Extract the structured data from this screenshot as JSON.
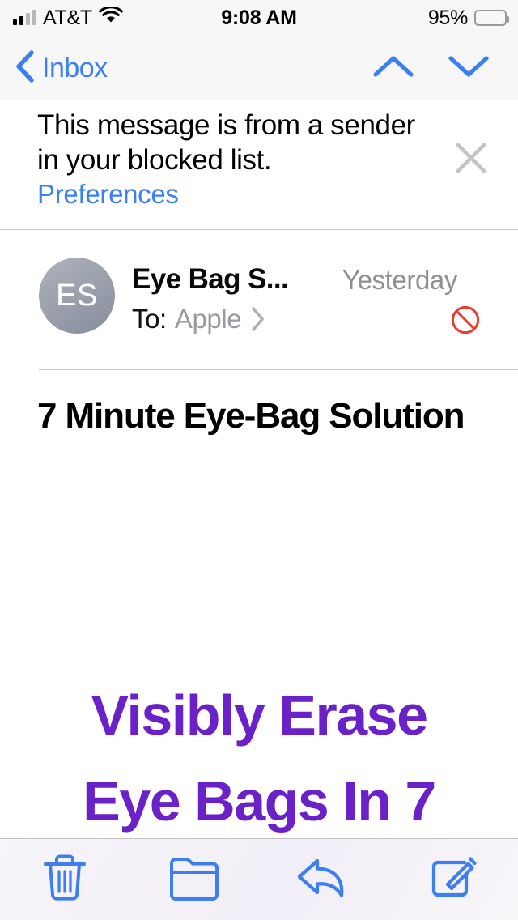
{
  "status_bar": {
    "carrier": "AT&T",
    "time": "9:08 AM",
    "battery_percent": "95%",
    "signal_icon": "signal-bars-icon",
    "wifi_icon": "wifi-icon",
    "battery_icon": "battery-icon"
  },
  "nav_bar": {
    "back_label": "Inbox",
    "back_icon": "chevron-left-icon",
    "previous_message_icon": "chevron-up-icon",
    "next_message_icon": "chevron-down-icon"
  },
  "blocked_banner": {
    "message": "This message is from a sender in your blocked list.",
    "link_label": "Preferences",
    "close_icon": "close-x-icon"
  },
  "sender": {
    "avatar_initials": "ES",
    "name": "Eye Bag S...",
    "date": "Yesterday",
    "to_label": "To:",
    "to_value": "Apple",
    "disclosure_icon": "chevron-right-icon",
    "blocked_icon": "blocked-circle-slash-icon"
  },
  "message": {
    "subject": "7 Minute Eye-Bag Solution",
    "body_line_1": "Visibly Erase",
    "body_line_2": "Eye Bags In 7"
  },
  "toolbar": {
    "buttons": [
      {
        "name": "trash-icon",
        "label": "Delete"
      },
      {
        "name": "folder-icon",
        "label": "Move"
      },
      {
        "name": "reply-icon",
        "label": "Reply"
      },
      {
        "name": "compose-icon",
        "label": "Compose"
      }
    ]
  },
  "colors": {
    "accent_blue": "#3b7ff0",
    "promo_purple": "#6b21c8",
    "blocked_red": "#e5402f",
    "secondary_gray": "#8e8e93"
  }
}
